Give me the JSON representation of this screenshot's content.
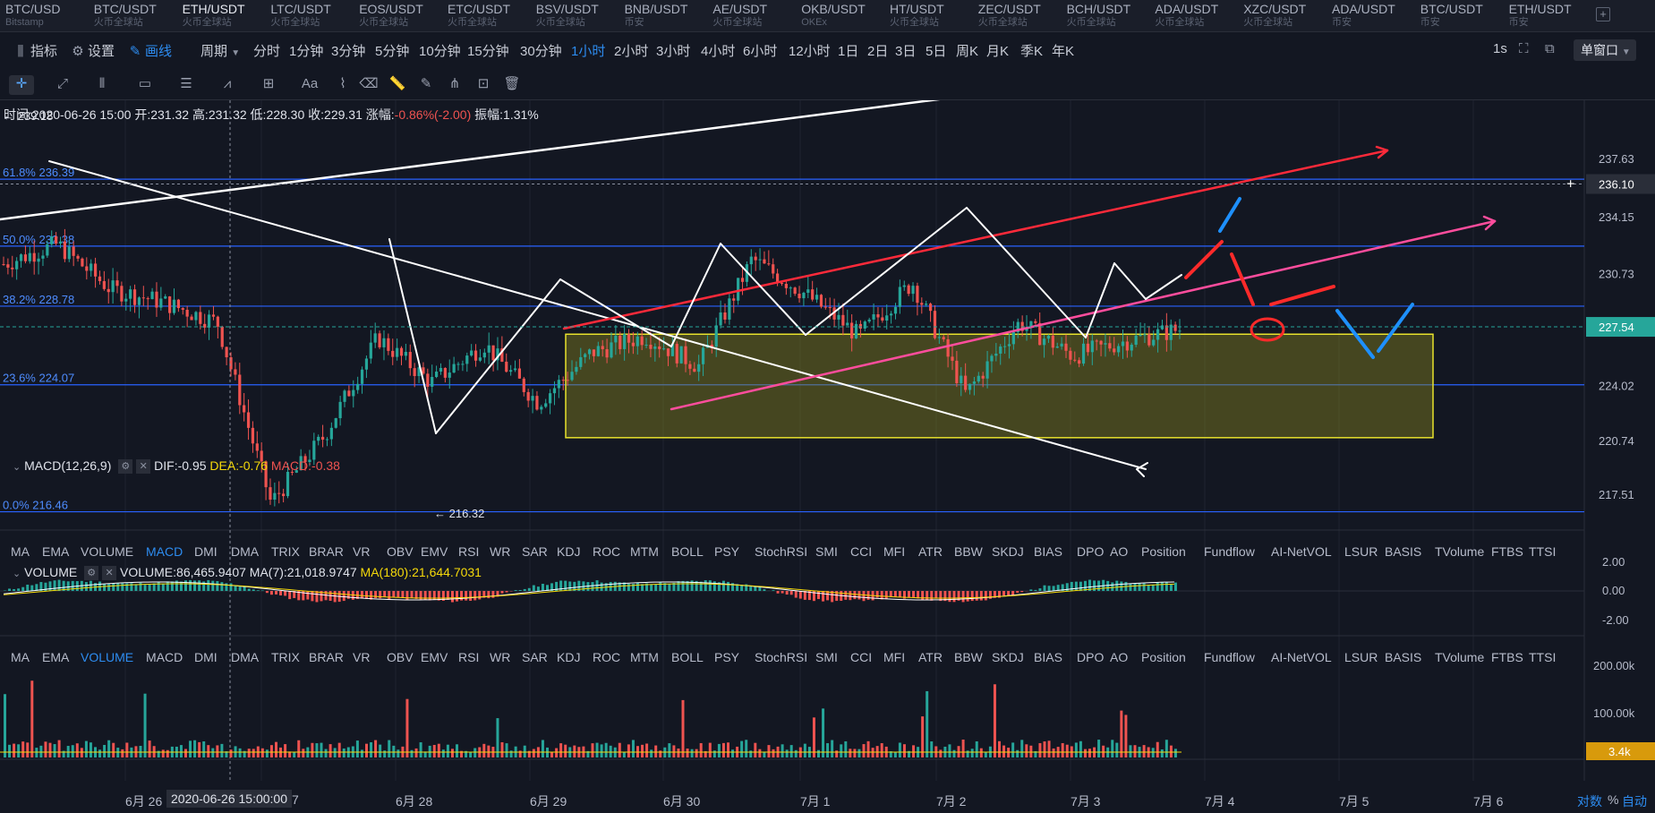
{
  "symbols": [
    {
      "name": "BTC/USD",
      "exchange": "Bitstamp"
    },
    {
      "name": "BTC/USDT",
      "exchange": "火币全球站"
    },
    {
      "name": "ETH/USDT",
      "exchange": "火币全球站"
    },
    {
      "name": "LTC/USDT",
      "exchange": "火币全球站"
    },
    {
      "name": "EOS/USDT",
      "exchange": "火币全球站"
    },
    {
      "name": "ETC/USDT",
      "exchange": "火币全球站"
    },
    {
      "name": "BSV/USDT",
      "exchange": "火币全球站"
    },
    {
      "name": "BNB/USDT",
      "exchange": "币安"
    },
    {
      "name": "AE/USDT",
      "exchange": "火币全球站"
    },
    {
      "name": "OKB/USDT",
      "exchange": "OKEx"
    },
    {
      "name": "HT/USDT",
      "exchange": "火币全球站"
    },
    {
      "name": "ZEC/USDT",
      "exchange": "火币全球站"
    },
    {
      "name": "BCH/USDT",
      "exchange": "火币全球站"
    },
    {
      "name": "ADA/USDT",
      "exchange": "火币全球站"
    },
    {
      "name": "XZC/USDT",
      "exchange": "火币全球站"
    },
    {
      "name": "ADA/USDT",
      "exchange": "币安"
    },
    {
      "name": "BTC/USDT",
      "exchange": "币安"
    },
    {
      "name": "ETH/USDT",
      "exchange": "币安"
    }
  ],
  "active_symbol_index": 2,
  "add_tab": "+",
  "toolbar": {
    "indicators": "指标",
    "settings": "设置",
    "draw": "画线",
    "period": "周期",
    "periods": [
      "分时",
      "1分钟",
      "3分钟",
      "5分钟",
      "10分钟",
      "15分钟",
      "30分钟",
      "1小时",
      "2小时",
      "3小时",
      "4小时",
      "6小时",
      "12小时",
      "1日",
      "2日",
      "3日",
      "5日",
      "周K",
      "月K",
      "季K",
      "年K"
    ],
    "active_period": "1小时",
    "refresh": "1s",
    "single_window": "单窗口"
  },
  "draw_tools": [
    "crosshair-icon",
    "trend-line-icon",
    "parallel-lines-icon",
    "rectangle-icon",
    "horizontal-lines-icon",
    "pattern-icon",
    "measure-icon",
    "text-icon",
    "brush-icon",
    "eraser-icon",
    "ruler-icon",
    "pencil-icon",
    "fibonacci-icon",
    "lock-icon",
    "trash-icon"
  ],
  "draw_text_tool": "Aa",
  "info": {
    "time_label": "时间:",
    "time": "2020-06-26 15:00",
    "open_label": "开:",
    "open": "231.32",
    "high_label": "高:",
    "high": "231.32",
    "low_label": "低:",
    "low": "228.30",
    "close_label": "收:",
    "close": "229.31",
    "change_label": "涨幅:",
    "change": "-0.86%(-2.00)",
    "amp_label": "振幅:",
    "amp": "1.31%"
  },
  "price_annotations": {
    "high_mark": "← 239.18",
    "low_mark": "← 216.32"
  },
  "fib_levels": [
    {
      "label": "61.8% 236.39",
      "price": 236.39
    },
    {
      "label": "50.0% 232.38",
      "price": 232.38
    },
    {
      "label": "38.2% 228.78",
      "price": 228.78
    },
    {
      "label": "23.6% 224.07",
      "price": 224.07
    },
    {
      "label": "0.0% 216.46",
      "price": 216.46
    }
  ],
  "price_axis": [
    "237.63",
    "234.15",
    "230.73",
    "227.54",
    "224.02",
    "220.74",
    "217.51"
  ],
  "price_axis_values": [
    237.63,
    234.15,
    230.73,
    227.54,
    224.02,
    220.74,
    217.51
  ],
  "crosshair_price": "236.10",
  "current_price": "227.54",
  "macd": {
    "name": "MACD(12,26,9)",
    "dif_label": "DIF:",
    "dif": "-0.95",
    "dea_label": "DEA:",
    "dea": "-0.76",
    "macd_label": "MACD:",
    "macd": "-0.38",
    "axis": [
      "2.00",
      "0.00",
      "-2.00"
    ]
  },
  "volume": {
    "name": "VOLUME",
    "value_label": "VOLUME:",
    "value": "86,465.9407",
    "ma7_label": "MA(7):",
    "ma7": "21,018.9747",
    "ma180_label": "MA(180):",
    "ma180": "21,644.7031",
    "axis": [
      "200.00k",
      "100.00k"
    ],
    "current": "3.4k"
  },
  "indicators": [
    "MA",
    "EMA",
    "VOLUME",
    "MACD",
    "DMI",
    "DMA",
    "TRIX",
    "BRAR",
    "VR",
    "OBV",
    "EMV",
    "RSI",
    "WR",
    "SAR",
    "KDJ",
    "ROC",
    "MTM",
    "BOLL",
    "PSY",
    "StochRSI",
    "SMI",
    "CCI",
    "MFI",
    "ATR",
    "BBW",
    "SKDJ",
    "BIAS",
    "DPO",
    "AO",
    "Position",
    "Fundflow",
    "AI-NetVOL",
    "LSUR",
    "BASIS",
    "TVolume",
    "FTBS",
    "TTSI"
  ],
  "indicators_active_row1": "MACD",
  "indicators_active_row2": "VOLUME",
  "dates": [
    "6月 26",
    "6月 28",
    "6月 29",
    "6月 30",
    "7月 1",
    "7月 2",
    "7月 3",
    "7月 4",
    "7月 5",
    "7月 6"
  ],
  "crosshair_date": "2020-06-26 15:00:00",
  "crosshair_date_tail": "7",
  "bottom_controls": {
    "log": "对数",
    "percent": "%",
    "auto": "自动"
  },
  "colors": {
    "up": "#26a69a",
    "down": "#ef5350",
    "fib": "#2962ff",
    "box": "#6b6a1e",
    "accent": "#2d8cf0"
  },
  "chart_data": {
    "type": "candlestick",
    "title": "ETH/USDT",
    "interval": "1小时",
    "x": [
      "6月 26",
      "6月 28",
      "6月 29",
      "6月 30",
      "7月 1",
      "7月 2",
      "7月 3"
    ],
    "price_range": [
      216.32,
      239.18
    ],
    "series": [
      {
        "values": [
          231.3,
          232.5,
          229.8,
          229.0,
          227.8,
          217.0,
          221.0,
          226.9,
          224.2,
          226.5,
          223.0,
          226.0,
          227.0,
          225.2,
          231.6,
          229.5,
          227.0,
          230.2,
          223.5,
          227.8,
          225.8,
          226.7,
          227.4
        ]
      }
    ]
  }
}
